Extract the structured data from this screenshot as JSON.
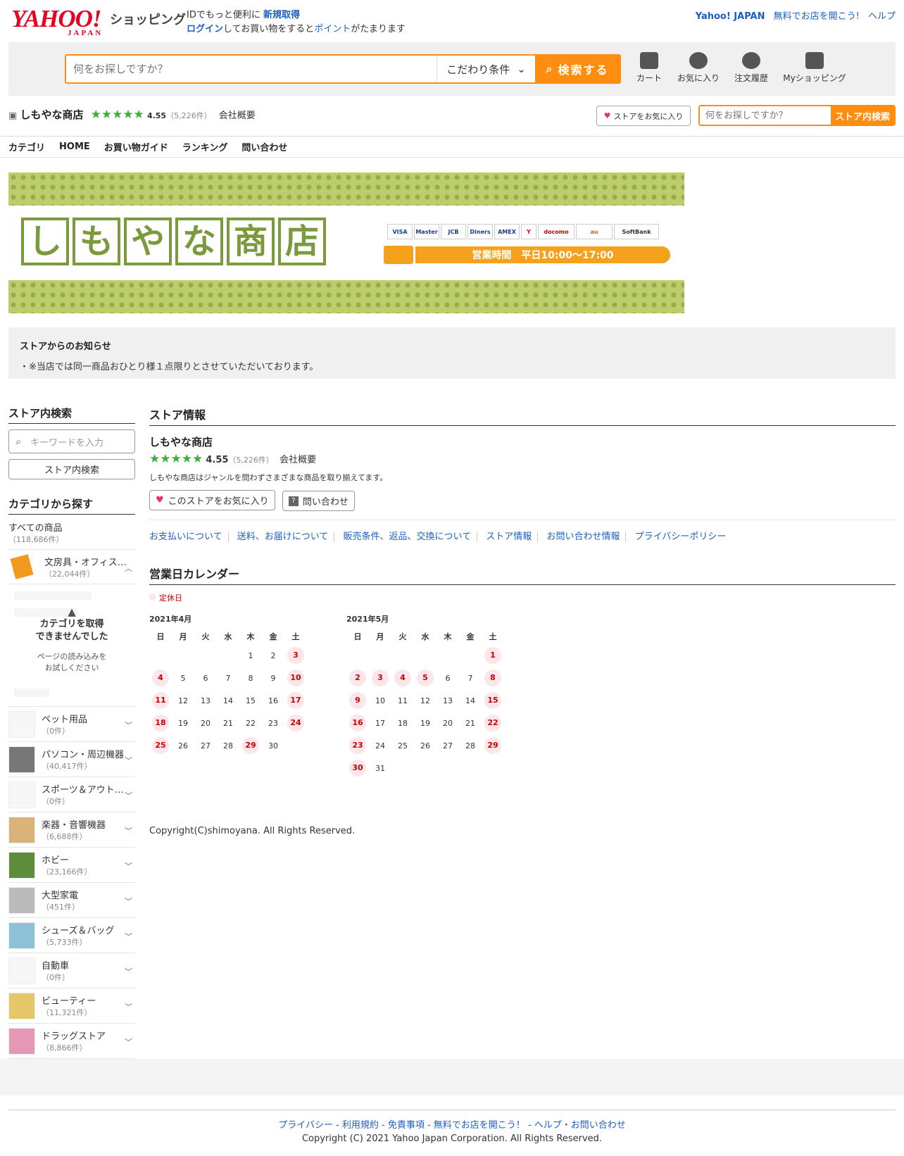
{
  "header": {
    "logo_main": "YAHOO!",
    "logo_sub": "JAPAN",
    "shop_title": "ショッピング",
    "login_line1_prefix": "IDでもっと便利に",
    "login_line1_link": "新規取得",
    "login_link": "ログイン",
    "login_line2_mid": "してお買い物をすると",
    "points_link": "ポイント",
    "login_line2_suffix": "がたまります",
    "top_links": [
      "Yahoo! JAPAN",
      "無料でお店を開こう!",
      "ヘルプ"
    ]
  },
  "search": {
    "placeholder": "何をお探しですか？",
    "conditions_label": "こだわり条件",
    "button_label": "検索する",
    "icons": [
      {
        "label": "カート",
        "icon": "cart-icon"
      },
      {
        "label": "お気に入り",
        "icon": "heart-icon"
      },
      {
        "label": "注文履歴",
        "icon": "history-icon"
      },
      {
        "label": "Myショッピング",
        "icon": "user-icon"
      }
    ]
  },
  "store": {
    "name": "しもやな商店",
    "rating": "4.55",
    "review_count": "（5,226件）",
    "company_link": "会社概要",
    "fav_button": "ストアをお気に入り",
    "search_placeholder": "何をお探しですか？",
    "search_button": "ストア内検索"
  },
  "nav": [
    "カテゴリ",
    "HOME",
    "お買い物ガイド",
    "ランキング",
    "問い合わせ"
  ],
  "banner": {
    "chars": [
      "し",
      "も",
      "や",
      "な",
      "商",
      "店"
    ],
    "cards": [
      "VISA",
      "Master",
      "JCB",
      "Diners",
      "AMEX",
      "Y",
      "docomo",
      "au",
      "SoftBank"
    ],
    "hours": "営業時間　平日10:00〜17:00"
  },
  "notice": {
    "title": "ストアからのお知らせ",
    "text": "・※当店では同一商品おひとり様１点限りとさせていただいております。"
  },
  "sidebar": {
    "search_title": "ストア内検索",
    "search_placeholder": "キーワードを入力",
    "search_button": "ストア内検索",
    "category_title": "カテゴリから探す",
    "all_products": "すべての商品",
    "all_count": "（118,686件）",
    "first_cat": {
      "name": "文房具・オフィス用品",
      "count": "（22,044件）"
    },
    "error_title1": "カテゴリを取得",
    "error_title2": "できませんでした",
    "error_msg1": "ページの読み込みを",
    "error_msg2": "お試しください",
    "categories": [
      {
        "name": "ペット用品",
        "count": "（0件）"
      },
      {
        "name": "パソコン・周辺機器",
        "count": "（40,417件）"
      },
      {
        "name": "スポーツ＆アウトドア",
        "count": "（0件）"
      },
      {
        "name": "楽器・音響機器",
        "count": "（6,688件）"
      },
      {
        "name": "ホビー",
        "count": "（23,166件）"
      },
      {
        "name": "大型家電",
        "count": "（451件）"
      },
      {
        "name": "シューズ＆バッグ",
        "count": "（5,733件）"
      },
      {
        "name": "自動車",
        "count": "（0件）"
      },
      {
        "name": "ビューティー",
        "count": "（11,321件）"
      },
      {
        "name": "ドラッグストア",
        "count": "（8,866件）"
      }
    ]
  },
  "store_info": {
    "title": "ストア情報",
    "name": "しもやな商店",
    "rating": "4.55",
    "review_count": "（5,226件）",
    "company_link": "会社概要",
    "description": "しもやな商店はジャンルを問わずさまざまな商品を取り揃えてます。",
    "fav_button": "このストアをお気に入り",
    "contact_button": "問い合わせ",
    "policy_links": [
      "お支払いについて",
      "送料、お届けについて",
      "販売条件、返品、交換について",
      "ストア情報",
      "お問い合わせ情報",
      "プライバシーポリシー"
    ]
  },
  "calendar": {
    "title": "営業日カレンダー",
    "legend": "定休日",
    "weekdays": [
      "日",
      "月",
      "火",
      "水",
      "木",
      "金",
      "土"
    ],
    "months": [
      {
        "label": "2021年4月",
        "weeks": [
          [
            "",
            "",
            "",
            "",
            "1",
            "2",
            "3"
          ],
          [
            "4",
            "5",
            "6",
            "7",
            "8",
            "9",
            "10"
          ],
          [
            "11",
            "12",
            "13",
            "14",
            "15",
            "16",
            "17"
          ],
          [
            "18",
            "19",
            "20",
            "21",
            "22",
            "23",
            "24"
          ],
          [
            "25",
            "26",
            "27",
            "28",
            "29",
            "30",
            ""
          ]
        ],
        "holidays": [
          "3",
          "4",
          "10",
          "11",
          "17",
          "18",
          "24",
          "25",
          "29"
        ]
      },
      {
        "label": "2021年5月",
        "weeks": [
          [
            "",
            "",
            "",
            "",
            "",
            "",
            "1"
          ],
          [
            "2",
            "3",
            "4",
            "5",
            "6",
            "7",
            "8"
          ],
          [
            "9",
            "10",
            "11",
            "12",
            "13",
            "14",
            "15"
          ],
          [
            "16",
            "17",
            "18",
            "19",
            "20",
            "21",
            "22"
          ],
          [
            "23",
            "24",
            "25",
            "26",
            "27",
            "28",
            "29"
          ],
          [
            "30",
            "31",
            "",
            "",
            "",
            "",
            ""
          ]
        ],
        "holidays": [
          "1",
          "2",
          "3",
          "4",
          "5",
          "8",
          "9",
          "15",
          "16",
          "22",
          "23",
          "29",
          "30"
        ]
      }
    ]
  },
  "copyright_store": "Copyright(C)shimoyana. All Rights Reserved.",
  "footer": {
    "links": "プライバシー - 利用規約 - 免責事項 - 無料でお店を開こう！ - ヘルプ・お問い合わせ",
    "copyright": "Copyright (C) 2021 Yahoo Japan Corporation. All Rights Reserved."
  },
  "colors": {
    "accent": "#ff8d0f",
    "yahoo_red": "#e60021",
    "star_green": "#3fae3b",
    "link": "#1a5fc2",
    "holiday": "#fde6ea"
  }
}
